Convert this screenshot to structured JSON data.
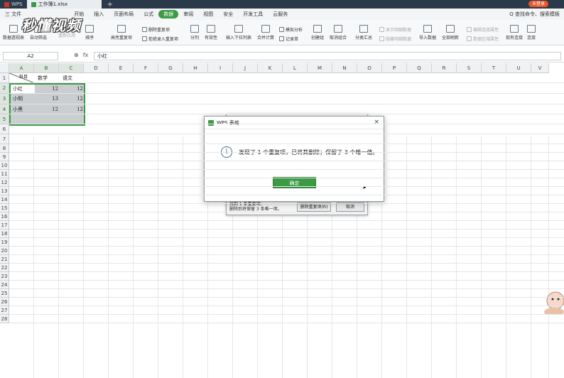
{
  "titlebar": {
    "app_tab": "WPS",
    "doc_tab": "工作簿1.xlsx",
    "login": "未登录"
  },
  "menubar": {
    "file": "三 文件",
    "items": [
      "开始",
      "插入",
      "页面布局",
      "公式",
      "数据",
      "审阅",
      "视图",
      "安全",
      "开发工具",
      "云服务"
    ],
    "active": "数据",
    "search": "Q 查找命令、搜索模板"
  },
  "ribbon": {
    "buttons": [
      "数据透视表",
      "自动筛选",
      "重新应用",
      "排序",
      "高亮重复项",
      "删除重复项",
      "拒绝录入重复项",
      "分列",
      "有效性",
      "插入下拉列表",
      "合并计算",
      "模拟分析",
      "记录单",
      "创建组",
      "取消组合",
      "分类汇总",
      "显示明细数据",
      "隐藏明细数据",
      "导入数据",
      "全部刷新",
      "编辑连接属性",
      "数据区域属性",
      "现有连接",
      "连接"
    ]
  },
  "watermark": "秒懂视频",
  "formula": {
    "namebox": "A2",
    "fx": "fx",
    "content": "小红"
  },
  "columns": [
    "A",
    "B",
    "C",
    "D",
    "E",
    "F",
    "G",
    "H",
    "I",
    "J",
    "K",
    "L",
    "M",
    "N",
    "O",
    "P",
    "Q",
    "R",
    "S",
    "T",
    "U",
    "V"
  ],
  "rows": [
    "1",
    "2",
    "3",
    "4",
    "5",
    "6",
    "7",
    "8",
    "9",
    "10",
    "11",
    "12",
    "13",
    "14",
    "15",
    "16",
    "17",
    "18",
    "19",
    "20",
    "21",
    "22",
    "23",
    "24",
    "25",
    "26",
    "27",
    "28"
  ],
  "table": {
    "corner_header": "科目",
    "headers": [
      "数学",
      "语文"
    ],
    "data": [
      {
        "name": "小红",
        "math": "12",
        "chinese": "12"
      },
      {
        "name": "小明",
        "math": "13",
        "chinese": "12"
      },
      {
        "name": "小黑",
        "math": "12",
        "chinese": "12"
      }
    ]
  },
  "back_dialog": {
    "message_line1": "找到 1 条重复项;",
    "message_line2": "删除后将保留 3 条唯一项。",
    "delete_button": "删除重复项(R)",
    "cancel_button": "取消"
  },
  "dialog": {
    "title": "WPS 表格",
    "close": "×",
    "info": "i",
    "message": "发现了 1 个重复项，已将其删除；保留了 3 个唯一值。",
    "ok_button": "确定"
  },
  "colors": {
    "accent": "#3c9a45",
    "selection_border": "#3c9a45",
    "titlebar": "#2b3a4a"
  }
}
